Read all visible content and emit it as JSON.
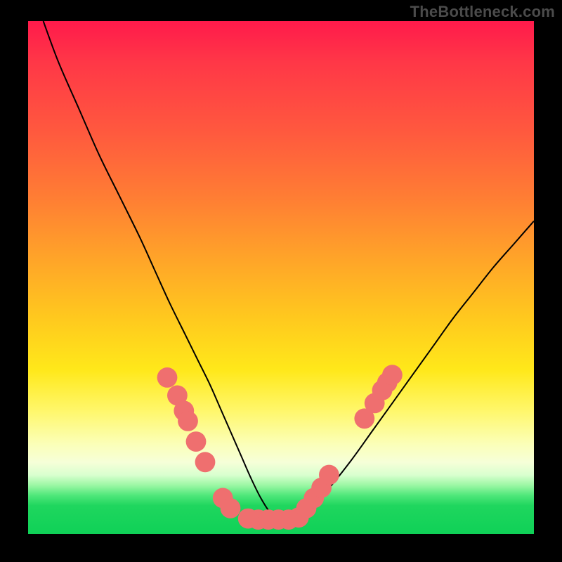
{
  "watermark": "TheBottleneck.com",
  "chart_data": {
    "type": "line",
    "title": "",
    "xlabel": "",
    "ylabel": "",
    "xlim": [
      0,
      100
    ],
    "ylim": [
      0,
      100
    ],
    "grid": false,
    "legend": false,
    "series": [
      {
        "name": "bottleneck-curve",
        "color": "#000000",
        "x": [
          3,
          6,
          10,
          14,
          18,
          22,
          25,
          28,
          31,
          33.5,
          36,
          38,
          40,
          42,
          44,
          46,
          48,
          50,
          53,
          56,
          60,
          64,
          68,
          72,
          76,
          80,
          84,
          88,
          92,
          96,
          100
        ],
        "values": [
          100,
          92,
          83,
          74,
          66,
          58,
          51.5,
          45,
          39,
          34,
          29,
          24.5,
          20,
          15.5,
          11,
          7,
          4,
          2.8,
          2.8,
          5,
          9.5,
          14.5,
          20,
          25.5,
          31,
          36.5,
          42,
          47,
          52,
          56.5,
          61
        ]
      }
    ],
    "markers": {
      "name": "highlight-points",
      "color": "#ef6f6f",
      "radius": 2.0,
      "points": [
        {
          "x": 27.5,
          "y": 30.5
        },
        {
          "x": 29.5,
          "y": 27.0
        },
        {
          "x": 30.8,
          "y": 24.0
        },
        {
          "x": 31.6,
          "y": 22.0
        },
        {
          "x": 33.2,
          "y": 18.0
        },
        {
          "x": 35.0,
          "y": 14.0
        },
        {
          "x": 38.5,
          "y": 7.0
        },
        {
          "x": 40.0,
          "y": 5.0
        },
        {
          "x": 43.5,
          "y": 3.0
        },
        {
          "x": 45.5,
          "y": 2.8
        },
        {
          "x": 47.5,
          "y": 2.8
        },
        {
          "x": 49.5,
          "y": 2.8
        },
        {
          "x": 51.5,
          "y": 2.8
        },
        {
          "x": 53.5,
          "y": 3.2
        },
        {
          "x": 55.0,
          "y": 5.0
        },
        {
          "x": 56.5,
          "y": 7.0
        },
        {
          "x": 58.0,
          "y": 9.0
        },
        {
          "x": 59.5,
          "y": 11.5
        },
        {
          "x": 66.5,
          "y": 22.5
        },
        {
          "x": 68.5,
          "y": 25.5
        },
        {
          "x": 70.0,
          "y": 28.0
        },
        {
          "x": 71.0,
          "y": 29.5
        },
        {
          "x": 72.0,
          "y": 31.0
        }
      ]
    },
    "gradient_bands": [
      {
        "color": "#ff1a4b",
        "stop": 0
      },
      {
        "color": "#ffa329",
        "stop": 46
      },
      {
        "color": "#ffe81a",
        "stop": 68
      },
      {
        "color": "#fbffb8",
        "stop": 83
      },
      {
        "color": "#4fe77a",
        "stop": 92
      },
      {
        "color": "#0fd157",
        "stop": 100
      }
    ]
  }
}
